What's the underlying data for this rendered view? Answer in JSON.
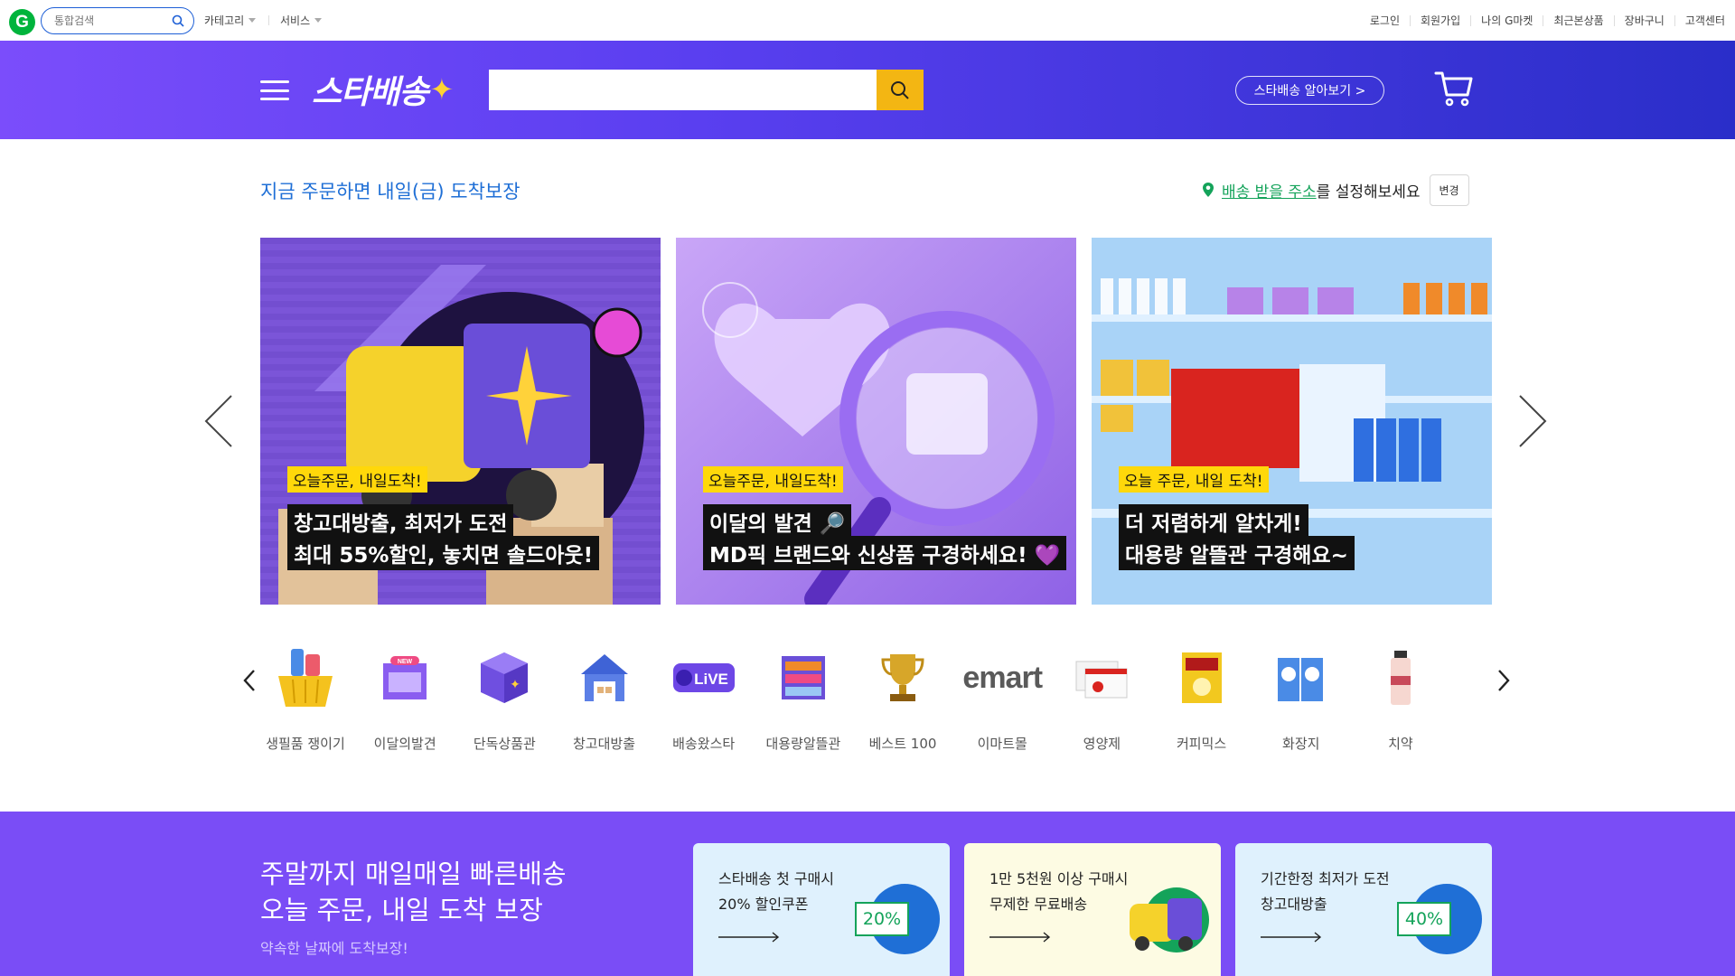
{
  "topbar": {
    "search_placeholder": "통합검색",
    "menus": [
      "카테고리",
      "서비스"
    ],
    "links": [
      "로그인",
      "회원가입",
      "나의 G마켓",
      "최근본상품",
      "장바구니",
      "고객센터"
    ]
  },
  "header": {
    "brand": "스타배송",
    "search_value": "",
    "learn_label": "스타배송 알아보기 >"
  },
  "delivery": {
    "message": "지금 주문하면 내일(금) 도착보장",
    "address_link": "배송 받을 주소",
    "address_rest": "를 설정해보세요",
    "change_label": "변경"
  },
  "banners": [
    {
      "tag": "오늘주문, 내일도착!",
      "line1": "창고대방출, 최저가 도전",
      "line2": "최대 55%할인, 놓치면 솔드아웃!",
      "bg": "#7b55d8"
    },
    {
      "tag": "오늘주문, 내일도착!",
      "line1": "이달의 발견 🔎",
      "line2": "MD픽 브랜드와 신상품 구경하세요! 💜",
      "bg": "#b68ef0"
    },
    {
      "tag": "오늘 주문, 내일 도착!",
      "line1": "더 저렴하게 알차게!",
      "line2": "대용량 알뜰관 구경해요~",
      "bg": "#a9d3f7"
    }
  ],
  "categories": [
    {
      "label": "생필품 쟁이기",
      "icon": "basket-icon"
    },
    {
      "label": "이달의발견",
      "icon": "store-new-icon"
    },
    {
      "label": "단독상품관",
      "icon": "box-icon"
    },
    {
      "label": "창고대방출",
      "icon": "warehouse-icon"
    },
    {
      "label": "배송왔스타",
      "icon": "live-icon"
    },
    {
      "label": "대용량알뜰관",
      "icon": "shelf-icon"
    },
    {
      "label": "베스트 100",
      "icon": "trophy-icon"
    },
    {
      "label": "이마트몰",
      "icon": "emart-logo-icon",
      "logo_text": "emart"
    },
    {
      "label": "영양제",
      "icon": "supplement-icon"
    },
    {
      "label": "커피믹스",
      "icon": "coffee-mix-icon"
    },
    {
      "label": "화장지",
      "icon": "tissue-icon"
    },
    {
      "label": "치약",
      "icon": "toothpaste-icon"
    }
  ],
  "promo": {
    "title1": "주말까지 매일매일 빠른배송",
    "title2": "오늘 주문, 내일 도착 보장",
    "sub": "약속한 날짜에 도착보장!",
    "cards": [
      {
        "line1": "스타배송 첫 구매시",
        "line2": "20% 할인쿠폰",
        "badge": "20%",
        "bg": "#dff1fd"
      },
      {
        "line1": "1만 5천원 이상 구매시",
        "line2": "무제한 무료배송",
        "badge": "",
        "bg": "#fdfbe3"
      },
      {
        "line1": "기간한정 최저가 도전",
        "line2": "창고대방출",
        "badge": "40%",
        "bg": "#dff1fd"
      }
    ]
  },
  "colors": {
    "brand_purple": "#7a4df6",
    "header_blue": "#2a2ec9",
    "search_yellow": "#f3b613",
    "link_green": "#14a35a",
    "accent_blue": "#1f6fd6"
  }
}
